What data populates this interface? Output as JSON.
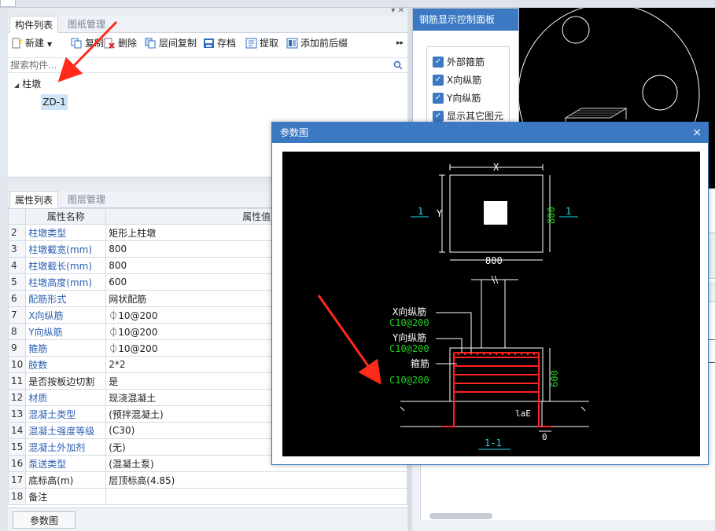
{
  "component_panel": {
    "tabs": [
      "构件列表",
      "图纸管理"
    ],
    "toolbar": [
      "新建",
      "复制",
      "删除",
      "层间复制",
      "存档",
      "提取",
      "添加前后缀"
    ],
    "more": "▸▸",
    "search_placeholder": "搜索构件...",
    "tree_root": "柱墩",
    "tree_child": "ZD-1"
  },
  "property_panel": {
    "tabs": [
      "属性列表",
      "图层管理"
    ],
    "headers": [
      "属性名称",
      "属性值"
    ],
    "rows": [
      {
        "num": "2",
        "name": "柱墩类型",
        "value": "矩形上柱墩",
        "blue": true
      },
      {
        "num": "3",
        "name": "柱墩截宽(mm)",
        "value": "800",
        "blue": true
      },
      {
        "num": "4",
        "name": "柱墩截长(mm)",
        "value": "800",
        "blue": true
      },
      {
        "num": "5",
        "name": "柱墩高度(mm)",
        "value": "600",
        "blue": true
      },
      {
        "num": "6",
        "name": "配筋形式",
        "value": "网状配筋",
        "blue": true
      },
      {
        "num": "7",
        "name": "X向纵筋",
        "value": "⏀10@200",
        "blue": true
      },
      {
        "num": "8",
        "name": "Y向纵筋",
        "value": "⏀10@200",
        "blue": true
      },
      {
        "num": "9",
        "name": "箍筋",
        "value": "⏀10@200",
        "blue": true
      },
      {
        "num": "10",
        "name": "肢数",
        "value": "2*2",
        "blue": true
      },
      {
        "num": "11",
        "name": "是否按板边切割",
        "value": "是",
        "blue": false
      },
      {
        "num": "12",
        "name": "材质",
        "value": "现浇混凝土",
        "blue": true
      },
      {
        "num": "13",
        "name": "混凝土类型",
        "value": "(预拌混凝土)",
        "blue": true
      },
      {
        "num": "14",
        "name": "混凝土强度等级",
        "value": "(C30)",
        "blue": true
      },
      {
        "num": "15",
        "name": "混凝土外加剂",
        "value": "(无)",
        "blue": true
      },
      {
        "num": "16",
        "name": "泵送类型",
        "value": "(混凝土泵)",
        "blue": true
      },
      {
        "num": "17",
        "name": "底标高(m)",
        "value": "层顶标高(4.85)",
        "blue": false
      },
      {
        "num": "18",
        "name": "备注",
        "value": "",
        "blue": false
      }
    ],
    "param_button": "参数图"
  },
  "control_panel": {
    "title": "钢筋显示控制面板",
    "checks": [
      "外部箍筋",
      "X向纵筋",
      "Y向纵筋",
      "显示其它图元"
    ]
  },
  "dialog": {
    "title": "参数图",
    "close": "×",
    "drawing": {
      "top_x": "X",
      "top_y": "Y",
      "width": "800",
      "length": "800",
      "section_mark": "1",
      "x_bar": "X向纵筋",
      "x_bar_spec": "C10@200",
      "y_bar": "Y向纵筋",
      "y_bar_spec": "C10@200",
      "stirrup": "箍筋",
      "stirrup_spec": "C10@200",
      "height": "600",
      "lae": "laE",
      "zero": "0",
      "section_label": "1-1"
    }
  },
  "colors": {
    "accent": "#3b79c2",
    "annotation_red": "#ff2a1a",
    "rebar_red": "#ff2020",
    "dim_green": "#22cc22",
    "cyan": "#22d8e8"
  }
}
